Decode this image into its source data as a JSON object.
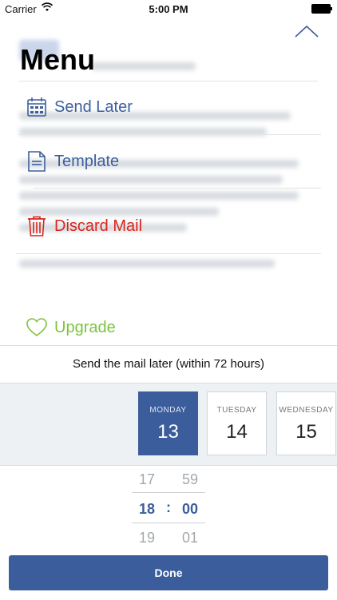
{
  "status_bar": {
    "carrier": "Carrier",
    "time": "5:00 PM"
  },
  "menu": {
    "title": "Menu",
    "items": [
      {
        "label": "Send Later",
        "icon": "calendar-icon",
        "color": "#3d5f9e"
      },
      {
        "label": "Template",
        "icon": "document-icon",
        "color": "#3d5f9e"
      },
      {
        "label": "Discard Mail",
        "icon": "trash-icon",
        "color": "#d9251b"
      },
      {
        "label": "Upgrade",
        "icon": "heart-icon",
        "color": "#7cc340"
      }
    ]
  },
  "send_later": {
    "title": "Send the mail later (within 72 hours)",
    "days": [
      {
        "name": "MONDAY",
        "number": "13",
        "selected": true
      },
      {
        "name": "TUESDAY",
        "number": "14",
        "selected": false
      },
      {
        "name": "WEDNESDAY",
        "number": "15",
        "selected": false
      }
    ],
    "time_picker": {
      "hours": [
        "17",
        "18",
        "19"
      ],
      "minutes": [
        "59",
        "00",
        "01"
      ],
      "separator": ":"
    },
    "done_label": "Done"
  },
  "colors": {
    "accent": "#3c5d9b",
    "danger": "#d9251b",
    "upgrade": "#7cc340"
  }
}
